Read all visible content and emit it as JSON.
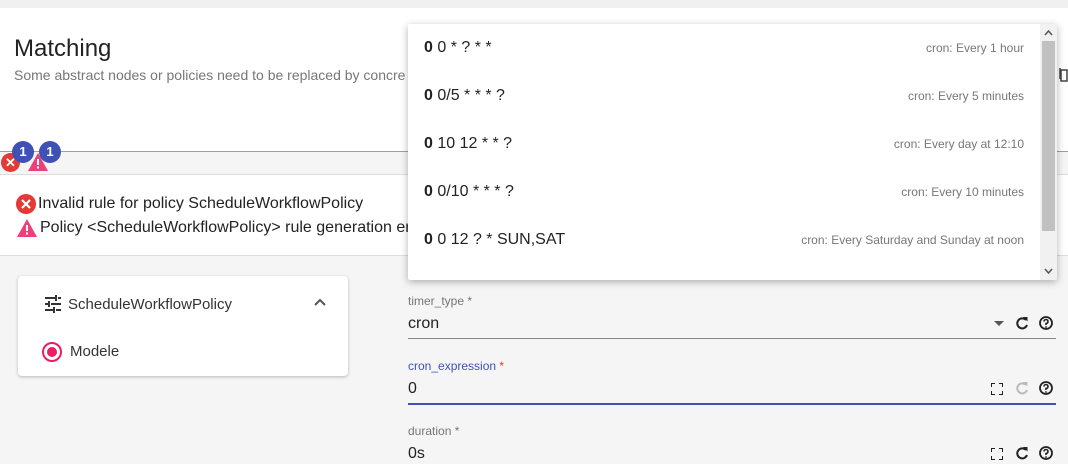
{
  "header": {
    "title": "Matching",
    "subtitle": "Some abstract nodes or policies need to be replaced by concre"
  },
  "status": {
    "error_icon": "✕",
    "error_count": "1",
    "warning_count": "1"
  },
  "messages": [
    {
      "icon": "error-icon",
      "text": "Invalid rule for policy ScheduleWorkflowPolicy"
    },
    {
      "icon": "warning-icon",
      "text": "Policy <ScheduleWorkflowPolicy> rule generation er"
    }
  ],
  "policy_card": {
    "title": "ScheduleWorkflowPolicy",
    "option": "Modele"
  },
  "form": {
    "timer_type": {
      "label": "timer_type",
      "required": "*",
      "value": "cron"
    },
    "cron_expression": {
      "label": "cron_expression",
      "required": "*",
      "value": "0"
    },
    "duration": {
      "label": "duration",
      "required": "*",
      "value": "0s"
    }
  },
  "autocomplete": {
    "options": [
      {
        "bold": "0",
        "rest": " 0 * ? * *",
        "desc": "cron: Every 1 hour"
      },
      {
        "bold": "0",
        "rest": " 0/5 * * * ?",
        "desc": "cron: Every 5 minutes"
      },
      {
        "bold": "0",
        "rest": " 10 12 * * ?",
        "desc": "cron: Every day at 12:10"
      },
      {
        "bold": "0",
        "rest": " 0/10 * * * ?",
        "desc": "cron: Every 10 minutes"
      },
      {
        "bold": "0",
        "rest": " 0 12 ? * SUN,SAT",
        "desc": "cron: Every Saturday and Sunday at noon"
      }
    ]
  },
  "colors": {
    "accent": "#3f51b5",
    "error": "#e53935",
    "warning": "#ec407a",
    "radio": "#e91e63"
  }
}
